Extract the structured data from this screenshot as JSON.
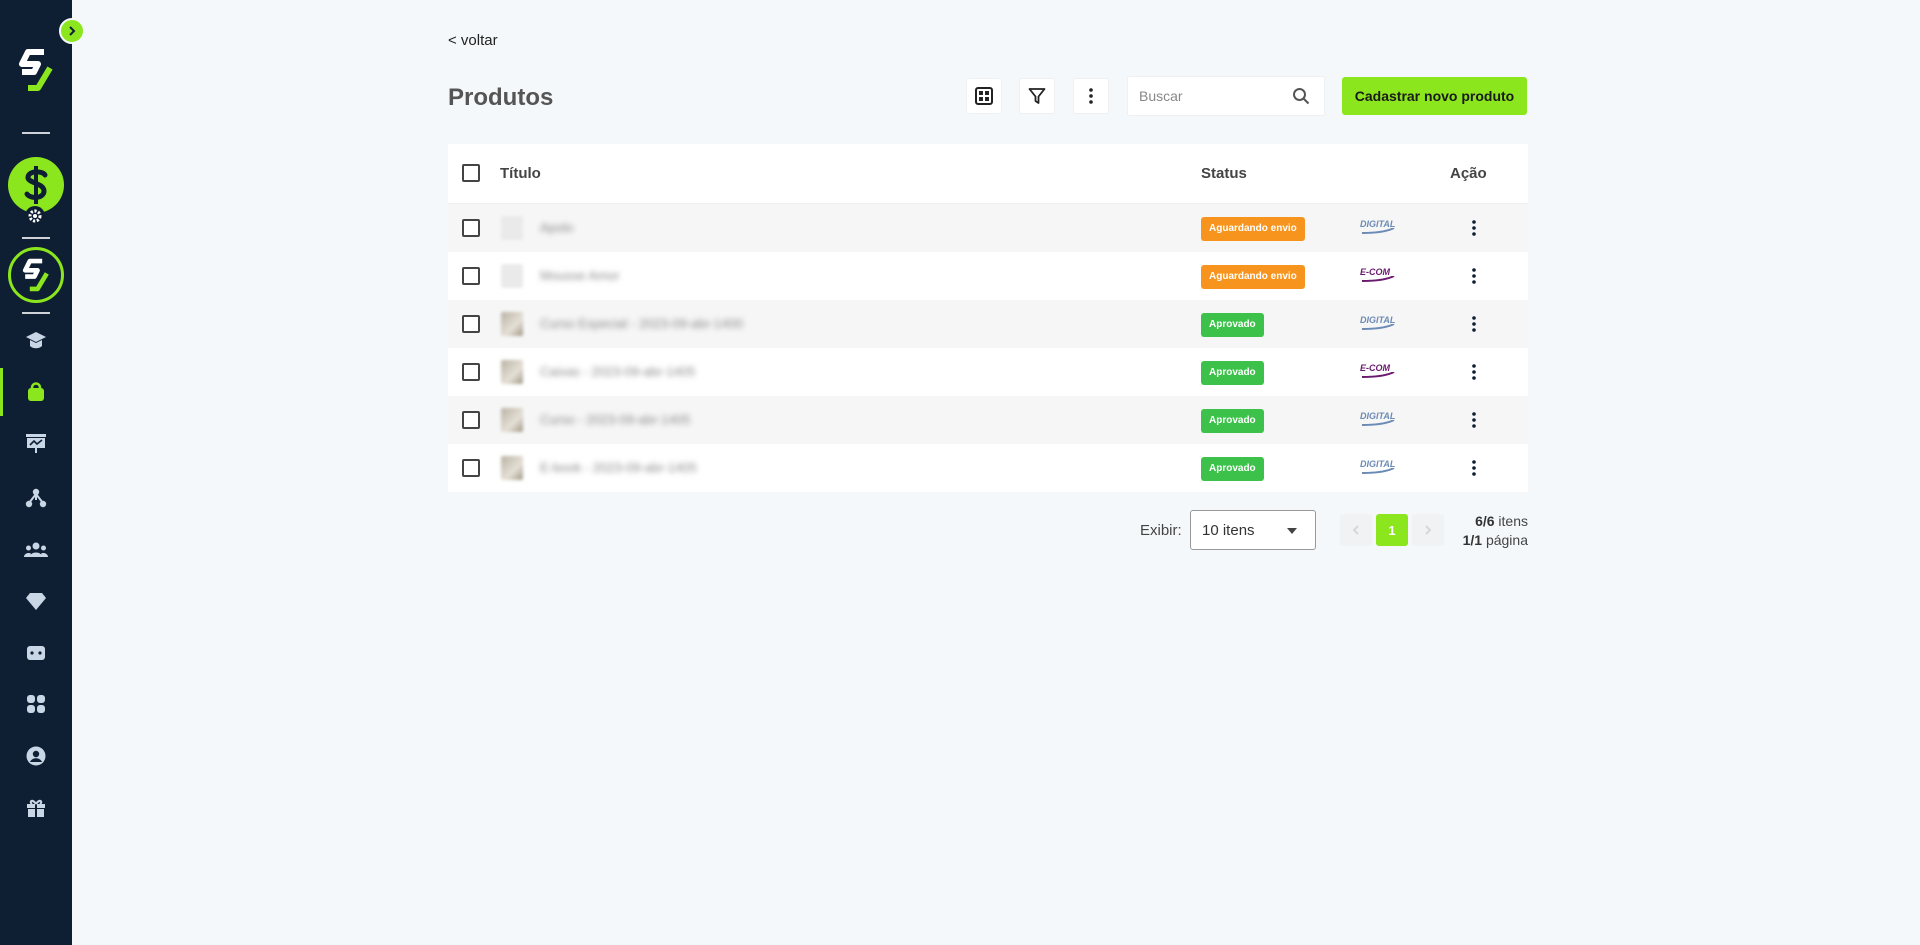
{
  "colors": {
    "sidebar": "#0f1f33",
    "accent": "#8ce61e",
    "pending": "#f7941d",
    "approved": "#3cc24a"
  },
  "sidebar": {
    "items": [
      {
        "name": "school-icon"
      },
      {
        "name": "shopping-bag-icon",
        "active": true
      },
      {
        "name": "presentation-chart-icon"
      },
      {
        "name": "network-icon"
      },
      {
        "name": "users-icon"
      },
      {
        "name": "diamond-icon"
      },
      {
        "name": "dice-icon"
      },
      {
        "name": "apps-icon"
      },
      {
        "name": "user-circle-icon"
      },
      {
        "name": "gift-icon"
      }
    ]
  },
  "header": {
    "back_label": "< voltar",
    "title": "Produtos",
    "search_placeholder": "Buscar",
    "cta_label": "Cadastrar novo produto"
  },
  "table": {
    "columns": {
      "title": "Título",
      "status": "Status",
      "action": "Ação"
    },
    "rows": [
      {
        "title": "Apolo",
        "status": "Aguardando envio",
        "status_color": "orange",
        "type": "DIGITAL"
      },
      {
        "title": "Mousse Amor",
        "status": "Aguardando envio",
        "status_color": "orange",
        "type": "E-COM"
      },
      {
        "title": "Curso Especial - 2023-09-abr-1400",
        "status": "Aprovado",
        "status_color": "green",
        "type": "DIGITAL"
      },
      {
        "title": "Caixas - 2023-09-abr-1405",
        "status": "Aprovado",
        "status_color": "green",
        "type": "E-COM"
      },
      {
        "title": "Curso - 2023-09-abr-1405",
        "status": "Aprovado",
        "status_color": "green",
        "type": "DIGITAL"
      },
      {
        "title": "E-book - 2023-09-abr-1405",
        "status": "Aprovado",
        "status_color": "green",
        "type": "DIGITAL"
      }
    ]
  },
  "pagination": {
    "show_label": "Exibir:",
    "page_size": "10 itens",
    "current_page": "1",
    "items_count": "6/6",
    "items_label": " itens",
    "pages_count": "1/1",
    "pages_label": " página"
  }
}
